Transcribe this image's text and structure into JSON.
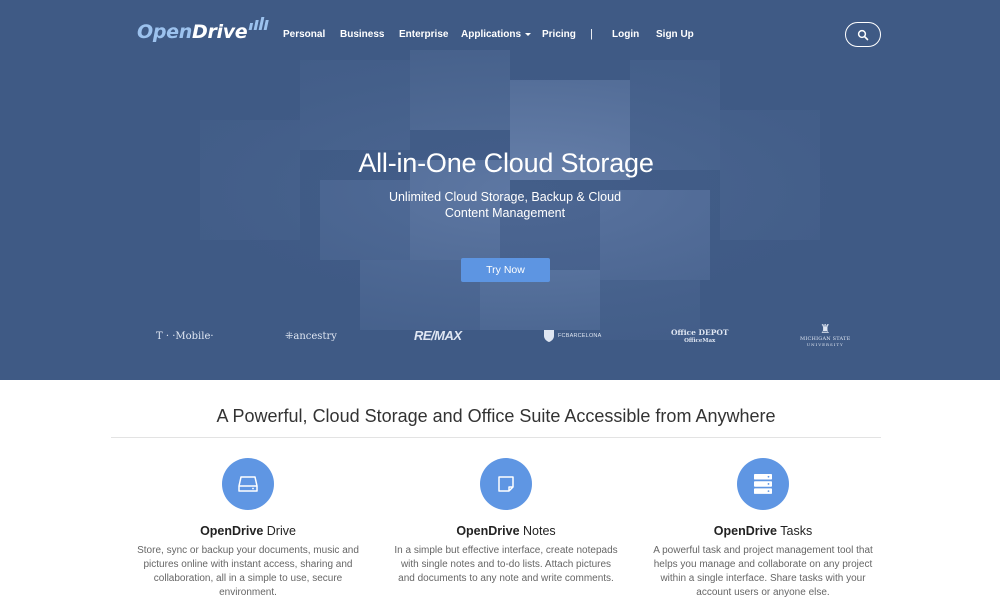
{
  "brand": {
    "logo_open": "Open",
    "logo_drive": "Drive"
  },
  "nav": {
    "items": [
      "Personal",
      "Business",
      "Enterprise",
      "Applications",
      "Pricing",
      "Login",
      "Sign Up"
    ],
    "separator": "|"
  },
  "hero": {
    "title": "All-in-One Cloud Storage",
    "subtitle_lines": [
      "Unlimited Cloud Storage, Backup & Cloud",
      "Content Management"
    ],
    "cta_label": "Try Now"
  },
  "clients": [
    {
      "name": "T-Mobile",
      "text": "T · ·Mobile·"
    },
    {
      "name": "Ancestry",
      "text": "ancestry"
    },
    {
      "name": "RE/MAX",
      "text": "RE/MAX"
    },
    {
      "name": "FC Barcelona",
      "text": "FCBARCELONA"
    },
    {
      "name": "Office Depot OfficeMax",
      "text": "Office DEPOT",
      "text2": "OfficeMax"
    },
    {
      "name": "Michigan State University",
      "text": "MICHIGAN STATE",
      "text2": "UNIVERSITY"
    }
  ],
  "features_section": {
    "title": "A Powerful, Cloud Storage and Office Suite Accessible from Anywhere"
  },
  "features": [
    {
      "icon": "hard-drive-icon",
      "title_bold": "OpenDrive",
      "title_rest": " Drive",
      "desc_lines": [
        "Store, sync or backup your documents, music and",
        "pictures online with instant access, sharing and",
        "collaboration, all in a simple to use, secure",
        "environment."
      ]
    },
    {
      "icon": "notes-icon",
      "title_bold": "OpenDrive",
      "title_rest": " Notes",
      "desc_lines": [
        "In a simple but effective interface, create notepads",
        "with single notes and to-do lists. Attach pictures",
        "and documents to any note and write comments."
      ]
    },
    {
      "icon": "server-stack-icon",
      "title_bold": "OpenDrive",
      "title_rest": " Tasks",
      "desc_lines": [
        "A powerful task and project management tool that",
        "helps you manage and collaborate on any project",
        "within a single interface. Share tasks with your",
        "account users or anyone else."
      ]
    }
  ],
  "colors": {
    "hero_bg": "#3f5a85",
    "accent": "#5f96e3",
    "logo_light": "#9cc2ee"
  }
}
